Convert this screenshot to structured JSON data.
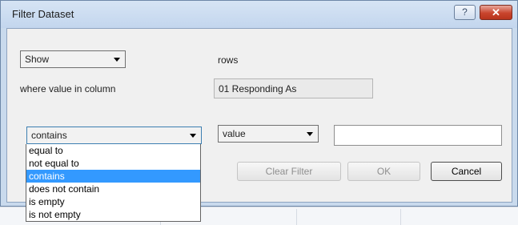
{
  "window": {
    "title": "Filter Dataset",
    "help_glyph": "?",
    "close_glyph": "✕"
  },
  "show_select": {
    "value": "Show"
  },
  "rows_label": "rows",
  "where_label": "where value in column",
  "column_value": "01 Responding As",
  "condition_select": {
    "value": "contains",
    "options": [
      "equal to",
      "not equal to",
      "contains",
      "does not contain",
      "is empty",
      "is not empty"
    ],
    "selected_index": 2
  },
  "value_type_select": {
    "value": "value"
  },
  "value_input": {
    "value": ""
  },
  "buttons": {
    "clear_filter": "Clear Filter",
    "ok": "OK",
    "cancel": "Cancel"
  },
  "colors": {
    "selection": "#3399ff",
    "close_button": "#c9442d"
  }
}
